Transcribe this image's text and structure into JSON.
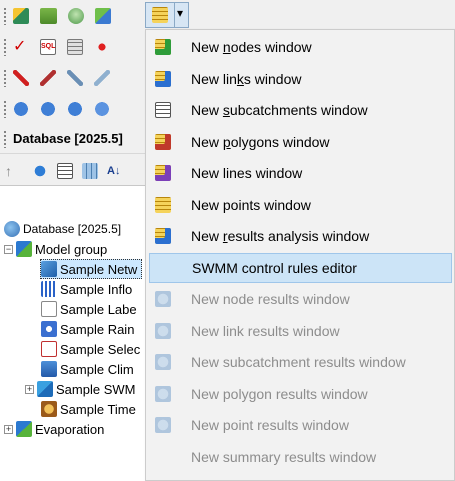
{
  "panel": {
    "title": "Database [2025.5]"
  },
  "tree": {
    "root": "Database [2025.5]",
    "group": "Model group",
    "items": [
      "Sample Netw",
      "Sample Inflo",
      "Sample Labe",
      "Sample Rain",
      "Sample Selec",
      "Sample Clim",
      "Sample SWM",
      "Sample Time"
    ],
    "evaporation": "Evaporation",
    "expand_symbol": "−",
    "collapsed_symbol": "+"
  },
  "menu": {
    "items": [
      {
        "label": "New nodes window",
        "accel_pre": "New ",
        "accel": "n",
        "accel_post": "odes window",
        "enabled": true,
        "icon": "grid-nodes-icon"
      },
      {
        "label": "New links window",
        "accel_pre": "New lin",
        "accel": "k",
        "accel_post": "s window",
        "enabled": true,
        "icon": "grid-links-icon"
      },
      {
        "label": "New subcatchments window",
        "accel_pre": "New ",
        "accel": "s",
        "accel_post": "ubcatchments window",
        "enabled": true,
        "icon": "grid-subcatchments-icon"
      },
      {
        "label": "New polygons window",
        "accel_pre": "New ",
        "accel": "p",
        "accel_post": "olygons window",
        "enabled": true,
        "icon": "grid-polygons-icon"
      },
      {
        "label": "New lines window",
        "accel_pre": "New lines window",
        "accel": "",
        "accel_post": "",
        "enabled": true,
        "icon": "grid-lines-icon"
      },
      {
        "label": "New points window",
        "accel_pre": "New points window",
        "accel": "",
        "accel_post": "",
        "enabled": true,
        "icon": "grid-points-icon"
      },
      {
        "label": "New results analysis window",
        "accel_pre": "New ",
        "accel": "r",
        "accel_post": "esults analysis window",
        "enabled": true,
        "icon": "grid-results-icon"
      },
      {
        "label": "SWMM control rules editor",
        "accel_pre": "SWMM control rules editor",
        "accel": "",
        "accel_post": "",
        "enabled": true,
        "hot": true,
        "icon": ""
      },
      {
        "label": "New node results window",
        "accel_pre": "New node results window",
        "accel": "",
        "accel_post": "",
        "enabled": false,
        "icon": "node-results-icon"
      },
      {
        "label": "New link results window",
        "accel_pre": "New link results window",
        "accel": "",
        "accel_post": "",
        "enabled": false,
        "icon": "link-results-icon"
      },
      {
        "label": "New subcatchment results window",
        "accel_pre": "New subcatchment results window",
        "accel": "",
        "accel_post": "",
        "enabled": false,
        "icon": "subcatchment-results-icon"
      },
      {
        "label": "New polygon results window",
        "accel_pre": "New polygon results window",
        "accel": "",
        "accel_post": "",
        "enabled": false,
        "icon": "polygon-results-icon"
      },
      {
        "label": "New point results window",
        "accel_pre": "New point results window",
        "accel": "",
        "accel_post": "",
        "enabled": false,
        "icon": "point-results-icon"
      },
      {
        "label": "New summary results window",
        "accel_pre": "New summary results window",
        "accel": "",
        "accel_post": "",
        "enabled": false,
        "icon": ""
      }
    ]
  },
  "toolbar": {
    "dropdown_glyph": "▾",
    "sql_label": "SQL",
    "sort_label": "A↓"
  },
  "colors": {
    "menu_bg": "#f2f2f2",
    "menu_hot": "#cce4f7",
    "disabled_text": "#8d8d8d",
    "tree_selected": "#cce8ff"
  }
}
